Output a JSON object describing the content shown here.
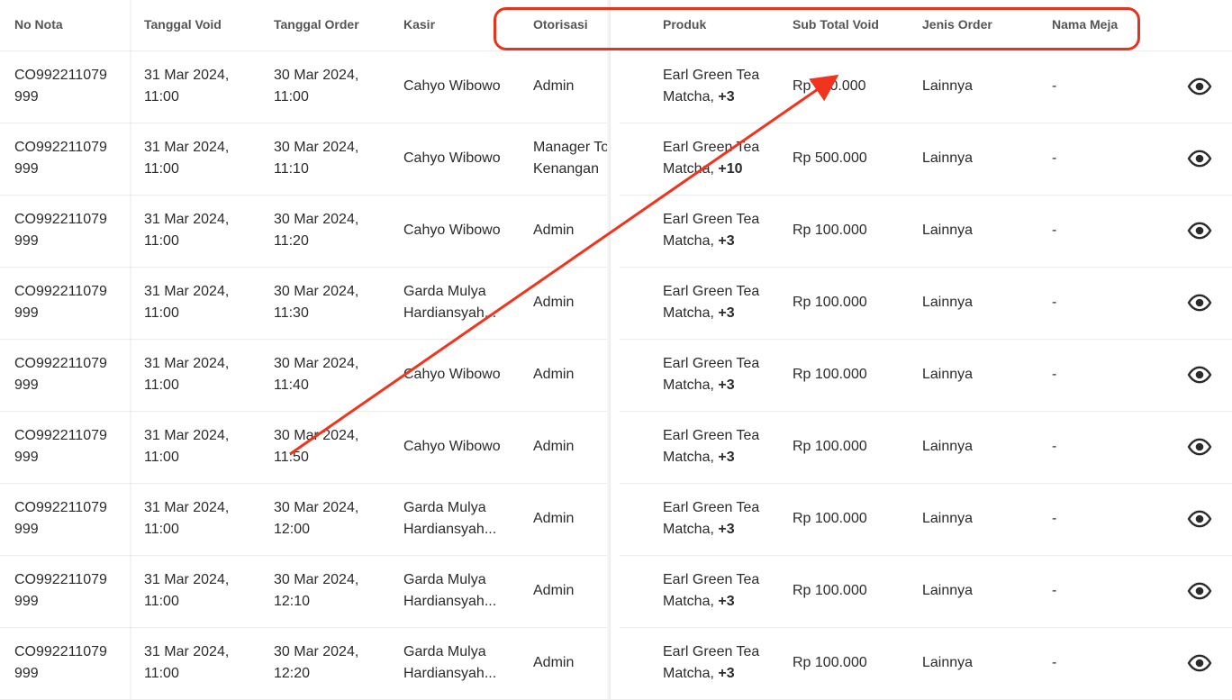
{
  "columns": {
    "no_nota": "No Nota",
    "tanggal_void": "Tanggal Void",
    "tanggal_order": "Tanggal Order",
    "kasir": "Kasir",
    "otorisasi": "Otorisasi",
    "produk": "Produk",
    "sub_total_void": "Sub Total Void",
    "jenis_order": "Jenis Order",
    "nama_meja": "Nama Meja"
  },
  "rows": [
    {
      "no_nota": "CO992211079\n999",
      "tanggal_void": "31 Mar 2024,\n11:00",
      "tanggal_order": "30 Mar 2024,\n11:00",
      "kasir": "Cahyo Wibowo",
      "otorisasi": "Admin",
      "produk_name": "Earl Green Tea",
      "produk_line2": "Matcha, ",
      "produk_extra": "+3",
      "sub_total": "Rp 110.000",
      "jenis_order": "Lainnya",
      "nama_meja": "-"
    },
    {
      "no_nota": "CO992211079\n999",
      "tanggal_void": "31 Mar 2024,\n11:00",
      "tanggal_order": "30 Mar 2024,\n11:10",
      "kasir": "Cahyo Wibowo",
      "otorisasi": "Manager Toko\nKenangan",
      "produk_name": "Earl Green Tea",
      "produk_line2": "Matcha, ",
      "produk_extra": "+10",
      "sub_total": "Rp 500.000",
      "jenis_order": "Lainnya",
      "nama_meja": "-"
    },
    {
      "no_nota": "CO992211079\n999",
      "tanggal_void": "31 Mar 2024,\n11:00",
      "tanggal_order": "30 Mar 2024,\n11:20",
      "kasir": "Cahyo Wibowo",
      "otorisasi": "Admin",
      "produk_name": "Earl Green Tea",
      "produk_line2": "Matcha, ",
      "produk_extra": "+3",
      "sub_total": "Rp 100.000",
      "jenis_order": "Lainnya",
      "nama_meja": "-"
    },
    {
      "no_nota": "CO992211079\n999",
      "tanggal_void": "31 Mar 2024,\n11:00",
      "tanggal_order": "30 Mar 2024,\n11:30",
      "kasir": "Garda Mulya\nHardiansyah...",
      "otorisasi": "Admin",
      "produk_name": "Earl Green Tea",
      "produk_line2": "Matcha, ",
      "produk_extra": "+3",
      "sub_total": "Rp 100.000",
      "jenis_order": "Lainnya",
      "nama_meja": "-"
    },
    {
      "no_nota": "CO992211079\n999",
      "tanggal_void": "31 Mar 2024,\n11:00",
      "tanggal_order": "30 Mar 2024,\n11:40",
      "kasir": "Cahyo Wibowo",
      "otorisasi": "Admin",
      "produk_name": "Earl Green Tea",
      "produk_line2": "Matcha, ",
      "produk_extra": "+3",
      "sub_total": "Rp 100.000",
      "jenis_order": "Lainnya",
      "nama_meja": "-"
    },
    {
      "no_nota": "CO992211079\n999",
      "tanggal_void": "31 Mar 2024,\n11:00",
      "tanggal_order": "30 Mar 2024,\n11:50",
      "kasir": "Cahyo Wibowo",
      "otorisasi": "Admin",
      "produk_name": "Earl Green Tea",
      "produk_line2": "Matcha, ",
      "produk_extra": "+3",
      "sub_total": "Rp 100.000",
      "jenis_order": "Lainnya",
      "nama_meja": "-"
    },
    {
      "no_nota": "CO992211079\n999",
      "tanggal_void": "31 Mar 2024,\n11:00",
      "tanggal_order": "30 Mar 2024,\n12:00",
      "kasir": "Garda Mulya\nHardiansyah...",
      "otorisasi": "Admin",
      "produk_name": "Earl Green Tea",
      "produk_line2": "Matcha, ",
      "produk_extra": "+3",
      "sub_total": "Rp 100.000",
      "jenis_order": "Lainnya",
      "nama_meja": "-"
    },
    {
      "no_nota": "CO992211079\n999",
      "tanggal_void": "31 Mar 2024,\n11:00",
      "tanggal_order": "30 Mar 2024,\n12:10",
      "kasir": "Garda Mulya\nHardiansyah...",
      "otorisasi": "Admin",
      "produk_name": "Earl Green Tea",
      "produk_line2": "Matcha, ",
      "produk_extra": "+3",
      "sub_total": "Rp 100.000",
      "jenis_order": "Lainnya",
      "nama_meja": "-"
    },
    {
      "no_nota": "CO992211079\n999",
      "tanggal_void": "31 Mar 2024,\n11:00",
      "tanggal_order": "30 Mar 2024,\n12:20",
      "kasir": "Garda Mulya\nHardiansyah...",
      "otorisasi": "Admin",
      "produk_name": "Earl Green Tea",
      "produk_line2": "Matcha, ",
      "produk_extra": "+3",
      "sub_total": "Rp 100.000",
      "jenis_order": "Lainnya",
      "nama_meja": "-"
    }
  ],
  "row_action_icon": "eye-icon",
  "annotation": {
    "color": "#e8331c"
  }
}
